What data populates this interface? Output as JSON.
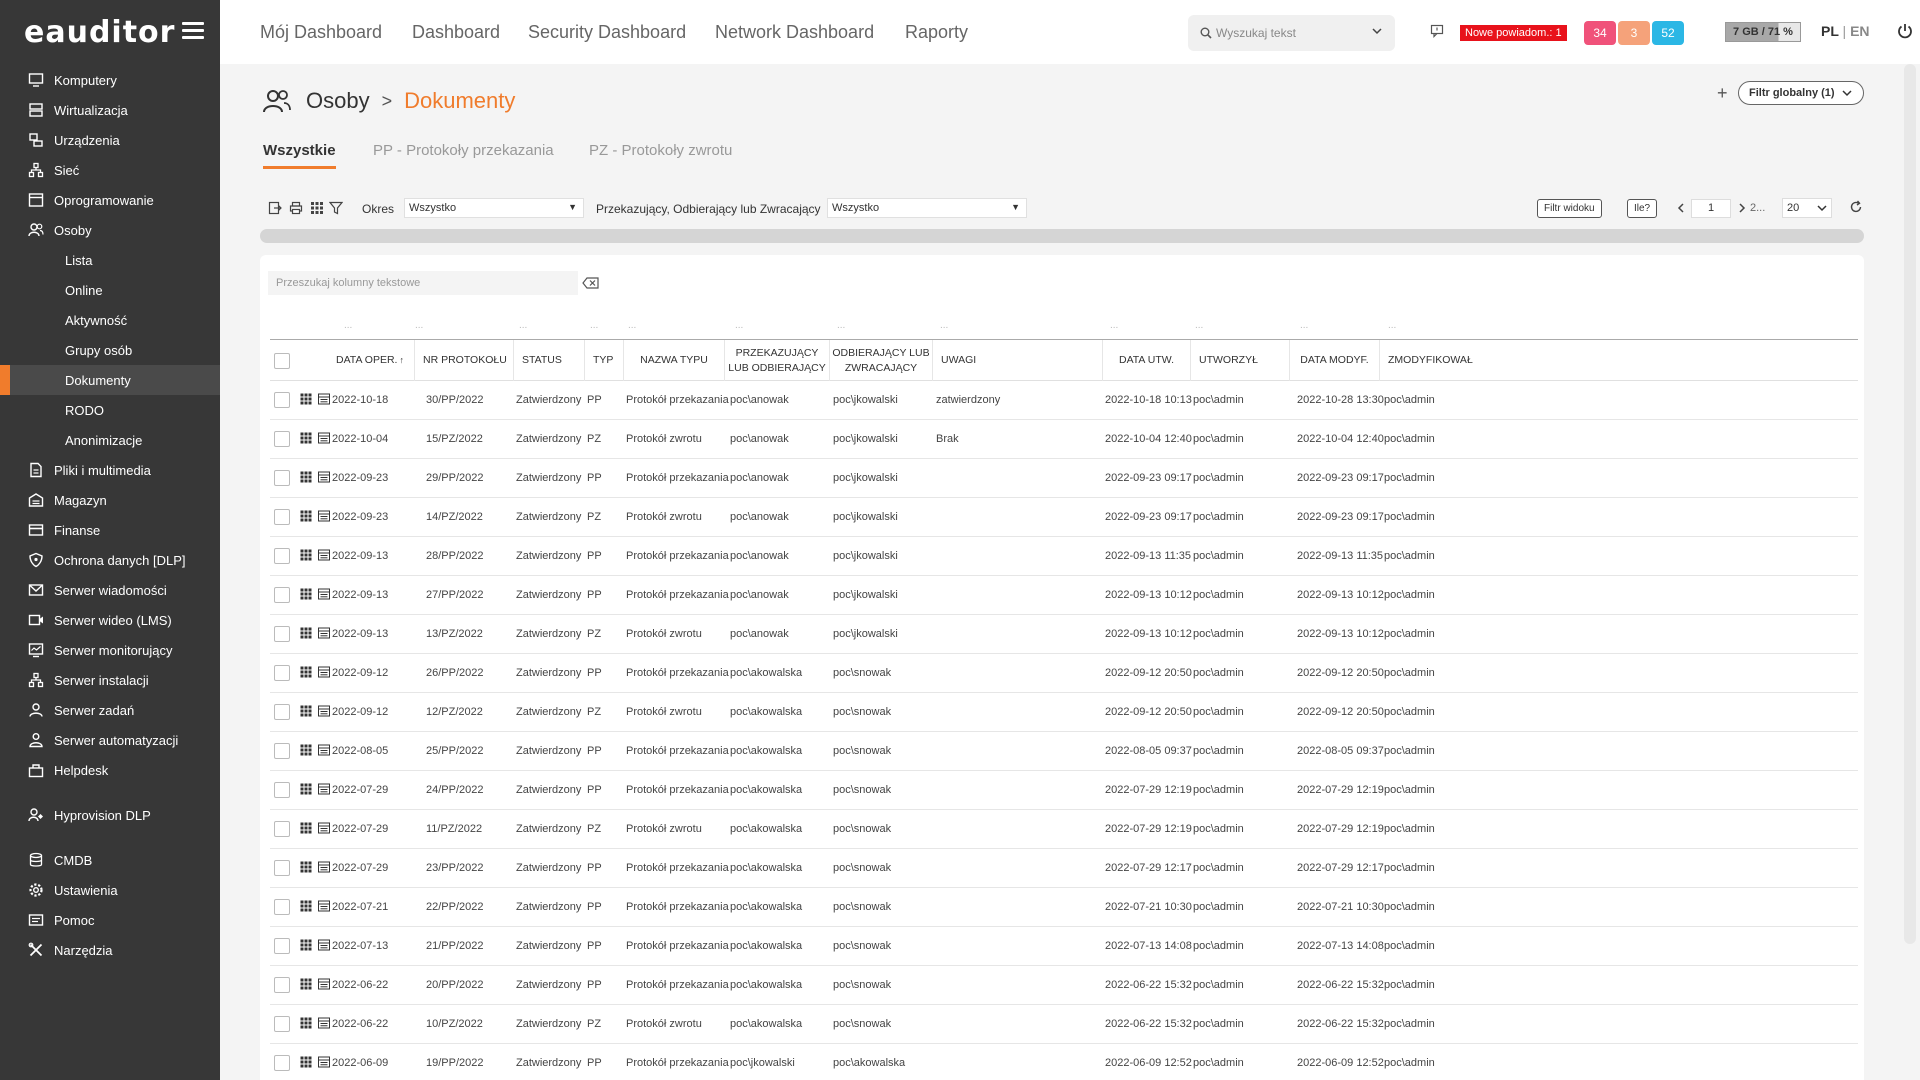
{
  "app": {
    "logo_text": "eauditor"
  },
  "sidebar": {
    "items": [
      {
        "label": "Komputery",
        "icon": "monitor-icon"
      },
      {
        "label": "Wirtualizacja",
        "icon": "server-icon"
      },
      {
        "label": "Urządzenia",
        "icon": "devices-icon"
      },
      {
        "label": "Sieć",
        "icon": "network-icon"
      },
      {
        "label": "Oprogramowanie",
        "icon": "software-icon"
      },
      {
        "label": "Osoby",
        "icon": "people-icon"
      },
      {
        "label": "Lista",
        "sub": true
      },
      {
        "label": "Online",
        "sub": true
      },
      {
        "label": "Aktywność",
        "sub": true
      },
      {
        "label": "Grupy osób",
        "sub": true
      },
      {
        "label": "Dokumenty",
        "sub": true,
        "active": true
      },
      {
        "label": "RODO",
        "sub": true
      },
      {
        "label": "Anonimizacje",
        "sub": true
      },
      {
        "label": "Pliki i multimedia",
        "icon": "file-icon"
      },
      {
        "label": "Magazyn",
        "icon": "warehouse-icon"
      },
      {
        "label": "Finanse",
        "icon": "finance-icon"
      },
      {
        "label": "Ochrona danych [DLP]",
        "icon": "shield-icon"
      },
      {
        "label": "Serwer wiadomości",
        "icon": "mail-icon"
      },
      {
        "label": "Serwer wideo (LMS)",
        "icon": "video-icon"
      },
      {
        "label": "Serwer monitorujący",
        "icon": "monitoring-icon"
      },
      {
        "label": "Serwer instalacji",
        "icon": "install-icon"
      },
      {
        "label": "Serwer zadań",
        "icon": "tasks-icon"
      },
      {
        "label": "Serwer automatyzacji",
        "icon": "automation-icon"
      },
      {
        "label": "Helpdesk",
        "icon": "helpdesk-icon"
      },
      {
        "gap": true
      },
      {
        "label": "Hyprovision DLP",
        "icon": "hyprovision-icon"
      },
      {
        "gap": true
      },
      {
        "label": "CMDB",
        "icon": "database-icon"
      },
      {
        "label": "Ustawienia",
        "icon": "gear-icon"
      },
      {
        "label": "Pomoc",
        "icon": "help-icon"
      },
      {
        "label": "Narzędzia",
        "icon": "tools-icon"
      }
    ]
  },
  "topnav": [
    {
      "label": "Mój Dashboard"
    },
    {
      "label": "Dashboard"
    },
    {
      "label": "Security Dashboard"
    },
    {
      "label": "Network Dashboard"
    },
    {
      "label": "Raporty"
    }
  ],
  "search": {
    "placeholder": "Wyszukaj tekst"
  },
  "notifications": {
    "label": "Nowe powiadom.: 1",
    "counts": [
      {
        "value": "34",
        "color": "#f0527a"
      },
      {
        "value": "3",
        "color": "#f5a27a"
      },
      {
        "value": "52",
        "color": "#2bb7e5"
      }
    ]
  },
  "storage": {
    "label": "7 GB / 71 %",
    "fill": 0.71
  },
  "lang": {
    "pl": "PL",
    "sep": "|",
    "en": "EN"
  },
  "breadcrumb": {
    "root": "Osoby",
    "separator": ">",
    "current": "Dokumenty"
  },
  "filter_global": {
    "label": "Filtr globalny (1)"
  },
  "add_label": "+",
  "tabs": [
    {
      "label": "Wszystkie",
      "active": true
    },
    {
      "label": "PP - Protokoły przekazania"
    },
    {
      "label": "PZ - Protokoły zwrotu"
    }
  ],
  "toolbar": {
    "okres_label": "Okres",
    "okres_value": "Wszystko",
    "party_label": "Przekazujący, Odbierający lub Zwracający",
    "party_value": "Wszystko",
    "filter_view": "Filtr widoku",
    "ile": "Ile?",
    "page": "1",
    "page_more": "2...",
    "page_size": "20"
  },
  "table": {
    "search_placeholder": "Przeszukaj kolumny tekstowe",
    "filter_placeholder": "...",
    "columns": [
      "DATA OPER.",
      "NR PROTOKOŁU",
      "STATUS",
      "TYP",
      "NAZWA TYPU",
      "PRZEKAZUJĄCY LUB ODBIERAJĄCY",
      "ODBIERAJĄCY LUB ZWRACAJĄCY",
      "UWAGI",
      "DATA UTW.",
      "UTWORZYŁ",
      "DATA MODYF.",
      "ZMODYFIKOWAŁ"
    ],
    "sort_indicator": "↑",
    "rows": [
      [
        "2022-10-18",
        "30/PP/2022",
        "Zatwierdzony",
        "PP",
        "Protokół przekazania",
        "poc\\anowak",
        "poc\\jkowalski",
        "zatwierdzony",
        "2022-10-18 10:13",
        "poc\\admin",
        "2022-10-28 13:30",
        "poc\\admin"
      ],
      [
        "2022-10-04",
        "15/PZ/2022",
        "Zatwierdzony",
        "PZ",
        "Protokół zwrotu",
        "poc\\anowak",
        "poc\\jkowalski",
        "Brak",
        "2022-10-04 12:40",
        "poc\\admin",
        "2022-10-04 12:40",
        "poc\\admin"
      ],
      [
        "2022-09-23",
        "29/PP/2022",
        "Zatwierdzony",
        "PP",
        "Protokół przekazania",
        "poc\\anowak",
        "poc\\jkowalski",
        "",
        "2022-09-23 09:17",
        "poc\\admin",
        "2022-09-23 09:17",
        "poc\\admin"
      ],
      [
        "2022-09-23",
        "14/PZ/2022",
        "Zatwierdzony",
        "PZ",
        "Protokół zwrotu",
        "poc\\anowak",
        "poc\\jkowalski",
        "",
        "2022-09-23 09:17",
        "poc\\admin",
        "2022-09-23 09:17",
        "poc\\admin"
      ],
      [
        "2022-09-13",
        "28/PP/2022",
        "Zatwierdzony",
        "PP",
        "Protokół przekazania",
        "poc\\anowak",
        "poc\\jkowalski",
        "",
        "2022-09-13 11:35",
        "poc\\admin",
        "2022-09-13 11:35",
        "poc\\admin"
      ],
      [
        "2022-09-13",
        "27/PP/2022",
        "Zatwierdzony",
        "PP",
        "Protokół przekazania",
        "poc\\anowak",
        "poc\\jkowalski",
        "",
        "2022-09-13 10:12",
        "poc\\admin",
        "2022-09-13 10:12",
        "poc\\admin"
      ],
      [
        "2022-09-13",
        "13/PZ/2022",
        "Zatwierdzony",
        "PZ",
        "Protokół zwrotu",
        "poc\\anowak",
        "poc\\jkowalski",
        "",
        "2022-09-13 10:12",
        "poc\\admin",
        "2022-09-13 10:12",
        "poc\\admin"
      ],
      [
        "2022-09-12",
        "26/PP/2022",
        "Zatwierdzony",
        "PP",
        "Protokół przekazania",
        "poc\\akowalska",
        "poc\\snowak",
        "",
        "2022-09-12 20:50",
        "poc\\admin",
        "2022-09-12 20:50",
        "poc\\admin"
      ],
      [
        "2022-09-12",
        "12/PZ/2022",
        "Zatwierdzony",
        "PZ",
        "Protokół zwrotu",
        "poc\\akowalska",
        "poc\\snowak",
        "",
        "2022-09-12 20:50",
        "poc\\admin",
        "2022-09-12 20:50",
        "poc\\admin"
      ],
      [
        "2022-08-05",
        "25/PP/2022",
        "Zatwierdzony",
        "PP",
        "Protokół przekazania",
        "poc\\akowalska",
        "poc\\snowak",
        "",
        "2022-08-05 09:37",
        "poc\\admin",
        "2022-08-05 09:37",
        "poc\\admin"
      ],
      [
        "2022-07-29",
        "24/PP/2022",
        "Zatwierdzony",
        "PP",
        "Protokół przekazania",
        "poc\\akowalska",
        "poc\\snowak",
        "",
        "2022-07-29 12:19",
        "poc\\admin",
        "2022-07-29 12:19",
        "poc\\admin"
      ],
      [
        "2022-07-29",
        "11/PZ/2022",
        "Zatwierdzony",
        "PZ",
        "Protokół zwrotu",
        "poc\\akowalska",
        "poc\\snowak",
        "",
        "2022-07-29 12:19",
        "poc\\admin",
        "2022-07-29 12:19",
        "poc\\admin"
      ],
      [
        "2022-07-29",
        "23/PP/2022",
        "Zatwierdzony",
        "PP",
        "Protokół przekazania",
        "poc\\akowalska",
        "poc\\snowak",
        "",
        "2022-07-29 12:17",
        "poc\\admin",
        "2022-07-29 12:17",
        "poc\\admin"
      ],
      [
        "2022-07-21",
        "22/PP/2022",
        "Zatwierdzony",
        "PP",
        "Protokół przekazania",
        "poc\\akowalska",
        "poc\\snowak",
        "",
        "2022-07-21 10:30",
        "poc\\admin",
        "2022-07-21 10:30",
        "poc\\admin"
      ],
      [
        "2022-07-13",
        "21/PP/2022",
        "Zatwierdzony",
        "PP",
        "Protokół przekazania",
        "poc\\akowalska",
        "poc\\snowak",
        "",
        "2022-07-13 14:08",
        "poc\\admin",
        "2022-07-13 14:08",
        "poc\\admin"
      ],
      [
        "2022-06-22",
        "20/PP/2022",
        "Zatwierdzony",
        "PP",
        "Protokół przekazania",
        "poc\\akowalska",
        "poc\\snowak",
        "",
        "2022-06-22 15:32",
        "poc\\admin",
        "2022-06-22 15:32",
        "poc\\admin"
      ],
      [
        "2022-06-22",
        "10/PZ/2022",
        "Zatwierdzony",
        "PZ",
        "Protokół zwrotu",
        "poc\\akowalska",
        "poc\\snowak",
        "",
        "2022-06-22 15:32",
        "poc\\admin",
        "2022-06-22 15:32",
        "poc\\admin"
      ],
      [
        "2022-06-09",
        "19/PP/2022",
        "Zatwierdzony",
        "PP",
        "Protokół przekazania",
        "poc\\jkowalski",
        "poc\\akowalska",
        "",
        "2022-06-09 12:52",
        "poc\\admin",
        "2022-06-09 12:52",
        "poc\\admin"
      ]
    ]
  }
}
